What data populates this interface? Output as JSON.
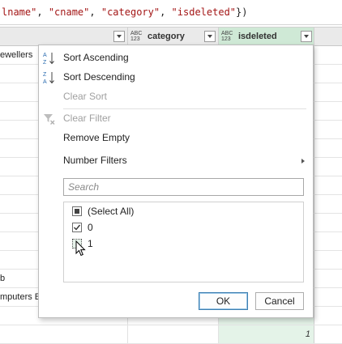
{
  "formula_bar": {
    "parts": [
      {
        "text": "lname\"",
        "kind": "str"
      },
      {
        "text": ", ",
        "kind": "plain"
      },
      {
        "text": "\"cname\"",
        "kind": "str"
      },
      {
        "text": ", ",
        "kind": "plain"
      },
      {
        "text": "\"category\"",
        "kind": "str"
      },
      {
        "text": ", ",
        "kind": "plain"
      },
      {
        "text": "\"isdeleted\"",
        "kind": "str"
      },
      {
        "text": "})",
        "kind": "plain"
      }
    ]
  },
  "columns": [
    {
      "type_badge_top": "ABC",
      "type_badge_bottom": "123",
      "label": "category"
    },
    {
      "type_badge_top": "ABC",
      "type_badge_bottom": "123",
      "label": "isdeleted"
    }
  ],
  "rows": [
    {
      "col_a": "ewellers"
    },
    {
      "col_a": ""
    },
    {
      "col_a": ""
    },
    {
      "col_a": ""
    },
    {
      "col_a": ""
    },
    {
      "col_a": ""
    },
    {
      "col_a": ""
    },
    {
      "col_a": ""
    },
    {
      "col_a": ""
    },
    {
      "col_a": ""
    },
    {
      "col_a": ""
    },
    {
      "col_a": ""
    },
    {
      "col_a": "b"
    },
    {
      "col_a": "mputers Ed"
    },
    {
      "col_a": ""
    },
    {
      "col_a": "",
      "col_c": "1"
    }
  ],
  "menu": {
    "sort_ascending": "Sort Ascending",
    "sort_descending": "Sort Descending",
    "clear_sort": "Clear Sort",
    "clear_filter": "Clear Filter",
    "remove_empty": "Remove Empty",
    "number_filters": "Number Filters"
  },
  "search": {
    "placeholder": "Search"
  },
  "filter_list": [
    {
      "label": "(Select All)",
      "state": "partial"
    },
    {
      "label": "0",
      "state": "checked"
    },
    {
      "label": "1",
      "state": "unchecked"
    }
  ],
  "buttons": {
    "ok": "OK",
    "cancel": "Cancel"
  },
  "colors": {
    "active_column": "#cfe9d6",
    "active_cells": "#e4f3e8",
    "string_literal": "#a31515"
  }
}
